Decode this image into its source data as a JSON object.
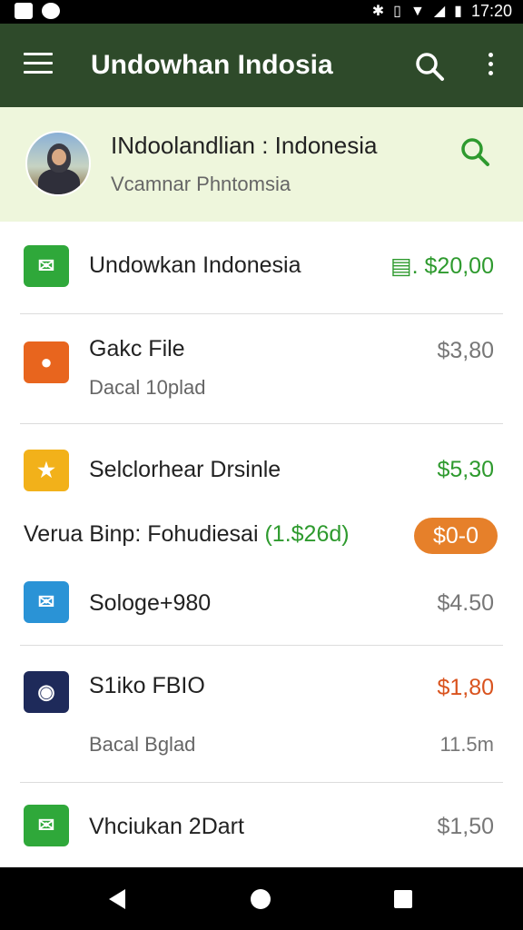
{
  "status_bar": {
    "time": "17:20"
  },
  "app_bar": {
    "title": "Undowhan Indosia"
  },
  "profile": {
    "name": "INdoolandlian : Indonesia",
    "subtitle": "Vcamnar Phntomsia"
  },
  "items": [
    {
      "label": "Undowkan Indonesia",
      "amount": "▤. $20,00",
      "icon": "mail-check-icon",
      "color": "#2fa83a",
      "amount_color": "green"
    },
    {
      "label": "Gakc File",
      "sub": "Dacal 10plad",
      "amount": "$3,80",
      "icon": "film-icon",
      "color": "#e8651e",
      "amount_color": "gray"
    },
    {
      "label": "Selclorhear Drsinle",
      "amount": "$5,30",
      "icon": "star-icon",
      "color": "#f2b11a",
      "amount_color": "green"
    },
    {
      "label": "Sologe+980",
      "amount": "$4.50",
      "icon": "mail-icon",
      "color": "#2a93d6",
      "amount_color": "gray"
    },
    {
      "label": "S1iko FBIO",
      "sub": "Bacal Bglad",
      "amount": "$1,80",
      "amount_sub": "11.5m",
      "icon": "chat-icon",
      "color": "#1e2a5a",
      "amount_color": "orange"
    },
    {
      "label": "Vhciukan 2Dart",
      "amount": "$1,50",
      "icon": "mail-check-icon",
      "color": "#2fa83a",
      "amount_color": "gray"
    }
  ],
  "promo": {
    "text": "Verua Binp: Fohudiesai",
    "highlight": "(1.$26d)",
    "pill": "$0-0"
  }
}
